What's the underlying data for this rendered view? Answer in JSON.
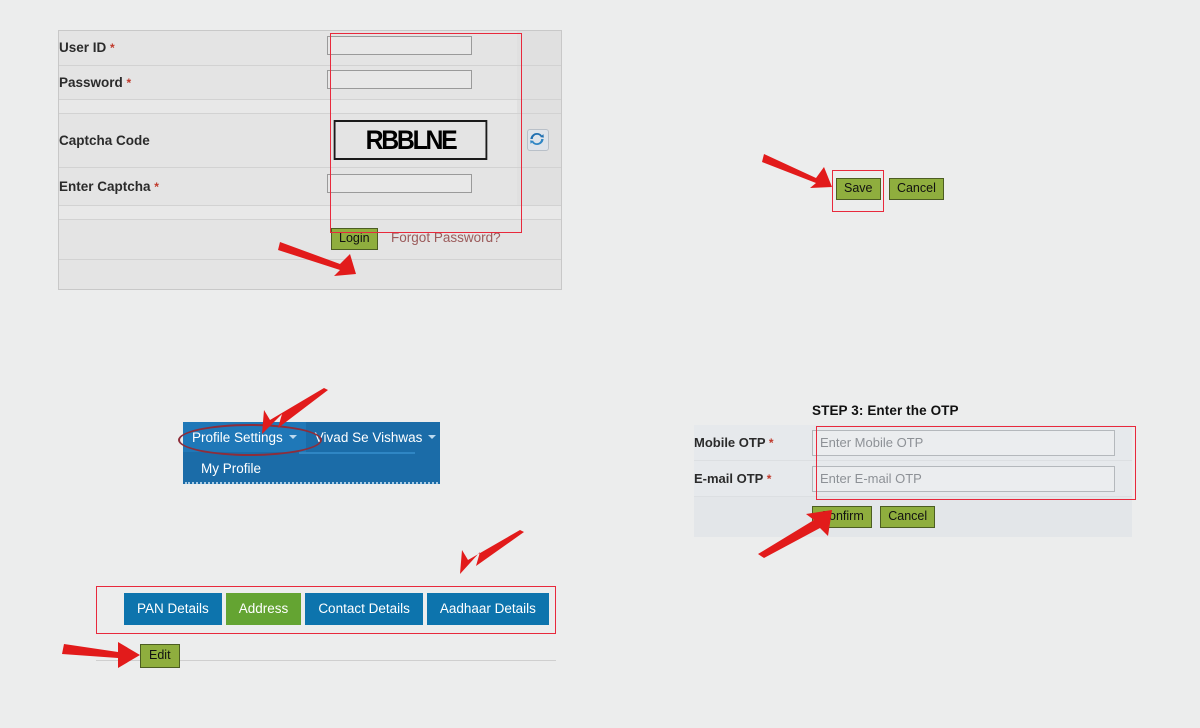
{
  "page": {
    "background_color": "#eceded",
    "accent_blue": "#0d74ad",
    "nav_blue": "#1b6ca8",
    "button_green": "#8fae3e",
    "tab_green": "#64a432",
    "highlight_red": "#e8293c",
    "arrow_red": "#e21b1b"
  },
  "login_form": {
    "rows": [
      {
        "label": "User ID",
        "required": "*",
        "value": "",
        "placeholder": ""
      },
      {
        "label": "Password",
        "required": "*",
        "value": "",
        "placeholder": ""
      }
    ],
    "captcha": {
      "label": "Captcha Code",
      "code": "RBBLNE",
      "refresh_icon": "refresh-icon"
    },
    "enter_captcha": {
      "label": "Enter Captcha",
      "required": "*",
      "value": "",
      "placeholder": ""
    },
    "login_button": "Login",
    "forgot_link": "Forgot Password?"
  },
  "save_cancel": {
    "save_label": "Save",
    "cancel_label": "Cancel"
  },
  "nav": {
    "items": [
      {
        "label": "Profile Settings",
        "has_caret": true,
        "active": true
      },
      {
        "label": "Vivad Se Vishwas",
        "has_caret": true,
        "active": false
      }
    ],
    "dropdown": [
      {
        "label": "My Profile"
      }
    ]
  },
  "tabs": {
    "items": [
      {
        "label": "PAN Details",
        "selected": false
      },
      {
        "label": "Address",
        "selected": true
      },
      {
        "label": "Contact Details",
        "selected": false
      },
      {
        "label": "Aadhaar Details",
        "selected": false
      }
    ],
    "edit_button": "Edit"
  },
  "otp": {
    "title": "STEP 3: Enter the OTP",
    "fields": [
      {
        "label": "Mobile OTP",
        "required": "*",
        "placeholder": "Enter Mobile OTP",
        "value": ""
      },
      {
        "label": "E-mail OTP",
        "required": "*",
        "placeholder": "Enter E-mail OTP",
        "value": ""
      }
    ],
    "confirm_label": "Confirm",
    "cancel_label": "Cancel"
  }
}
